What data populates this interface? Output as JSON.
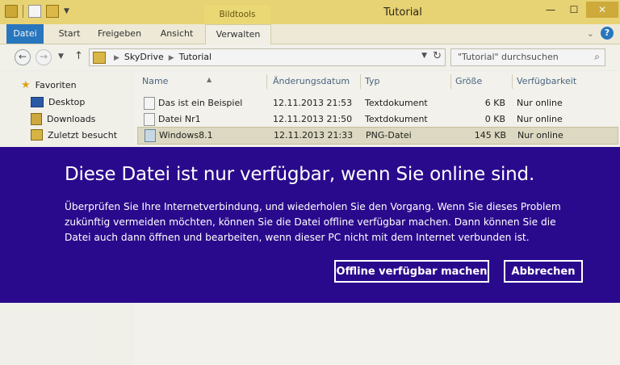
{
  "window": {
    "title": "Tutorial",
    "context_tab": "Bildtools",
    "controls": {
      "minimize": "—",
      "maximize": "☐",
      "close": "✕"
    }
  },
  "ribbon": {
    "tabs": [
      "Datei",
      "Start",
      "Freigeben",
      "Ansicht",
      "Verwalten"
    ],
    "help": "?",
    "expand": "⌄"
  },
  "address": {
    "path": [
      "SkyDrive",
      "Tutorial"
    ],
    "search_placeholder": "\"Tutorial\" durchsuchen"
  },
  "nav_pane": {
    "favorites_label": "Favoriten",
    "items": [
      "Desktop",
      "Downloads",
      "Zuletzt besucht"
    ]
  },
  "file_list": {
    "columns": [
      "Name",
      "Änderungsdatum",
      "Typ",
      "Größe",
      "Verfügbarkeit"
    ],
    "rows": [
      {
        "name": "Das ist ein Beispiel",
        "date": "12.11.2013 21:53",
        "type": "Textdokument",
        "size": "6 KB",
        "availability": "Nur online"
      },
      {
        "name": "Datei Nr1",
        "date": "12.11.2013 21:50",
        "type": "Textdokument",
        "size": "0 KB",
        "availability": "Nur online"
      },
      {
        "name": "Windows8.1",
        "date": "12.11.2013 21:33",
        "type": "PNG-Datei",
        "size": "145 KB",
        "availability": "Nur online"
      }
    ]
  },
  "dialog": {
    "title": "Diese Datei ist nur verfügbar, wenn Sie online sind.",
    "body": "Überprüfen Sie Ihre Internetverbindung, und wiederholen Sie den Vorgang. Wenn Sie dieses Problem\nzukünftig vermeiden möchten, können Sie die Datei offline verfügbar machen. Dann können Sie die\nDatei auch dann öffnen und bearbeiten, wenn dieser PC nicht mit dem Internet verbunden ist.",
    "primary_button": "Offline verfügbar machen",
    "cancel_button": "Abbrechen",
    "background_color": "#2a0a8c"
  }
}
